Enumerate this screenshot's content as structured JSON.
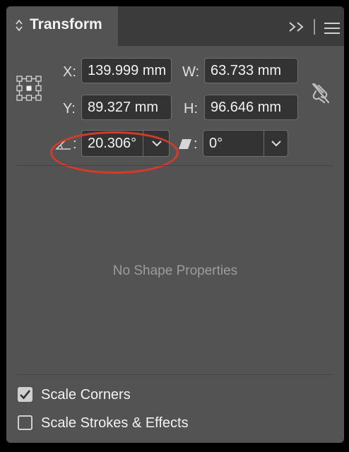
{
  "panel": {
    "tab_title": "Transform",
    "icons": {
      "tab_chevron": "updown-chevron-icon",
      "collapse": "double-chevron-right-icon",
      "menu": "hamburger-menu-icon",
      "reference_point": "reference-point-grid-icon",
      "constrain": "unlinked-chain-icon",
      "rotate": "angle-icon",
      "shear": "shear-icon",
      "dropdown": "chevron-down-icon"
    }
  },
  "transform": {
    "x_label": "X:",
    "x_value": "139.999 mm",
    "y_label": "Y:",
    "y_value": "89.327 mm",
    "w_label": "W:",
    "w_value": "63.733 mm",
    "h_label": "H:",
    "h_value": "96.646 mm",
    "rotate_colon": ":",
    "rotate_value": "20.306°",
    "shear_colon": ":",
    "shear_value": "0°"
  },
  "shape": {
    "empty_message": "No Shape Properties"
  },
  "options": {
    "scale_corners_label": "Scale Corners",
    "scale_corners_checked": true,
    "scale_strokes_label": "Scale Strokes & Effects",
    "scale_strokes_checked": false
  },
  "colors": {
    "panel_bg": "#535353",
    "field_bg": "#333333",
    "highlight": "#d83a2a"
  }
}
